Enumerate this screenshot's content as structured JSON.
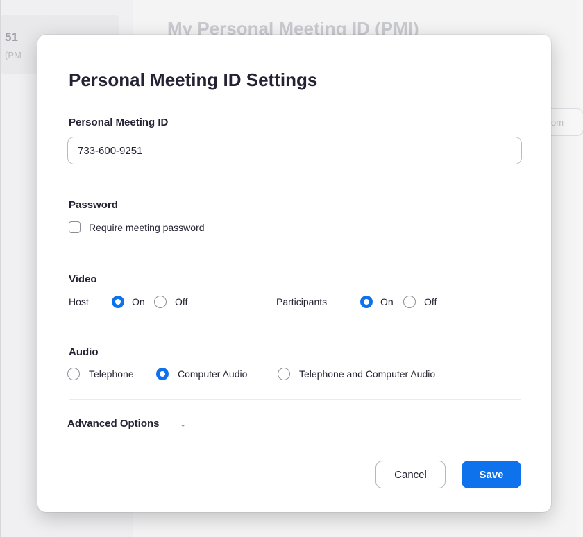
{
  "background": {
    "title": "My Personal Meeting ID (PMI)",
    "left_number": "51",
    "left_sub": "(PM",
    "right_button": "om"
  },
  "dialog": {
    "title": "Personal Meeting ID Settings",
    "pmi": {
      "label": "Personal Meeting ID",
      "value": "733-600-9251"
    },
    "password": {
      "label": "Password",
      "require_label": "Require meeting password",
      "checked": false
    },
    "video": {
      "label": "Video",
      "host_label": "Host",
      "participants_label": "Participants",
      "on_label": "On",
      "off_label": "Off",
      "host_selected": "On",
      "participants_selected": "On"
    },
    "audio": {
      "label": "Audio",
      "options": [
        "Telephone",
        "Computer Audio",
        "Telephone and Computer Audio"
      ],
      "selected": "Computer Audio"
    },
    "advanced_label": "Advanced Options",
    "cancel_label": "Cancel",
    "save_label": "Save"
  },
  "colors": {
    "accent": "#0e72ed",
    "text": "#232333"
  },
  "icons": {
    "advanced": "chevron-down-icon"
  }
}
